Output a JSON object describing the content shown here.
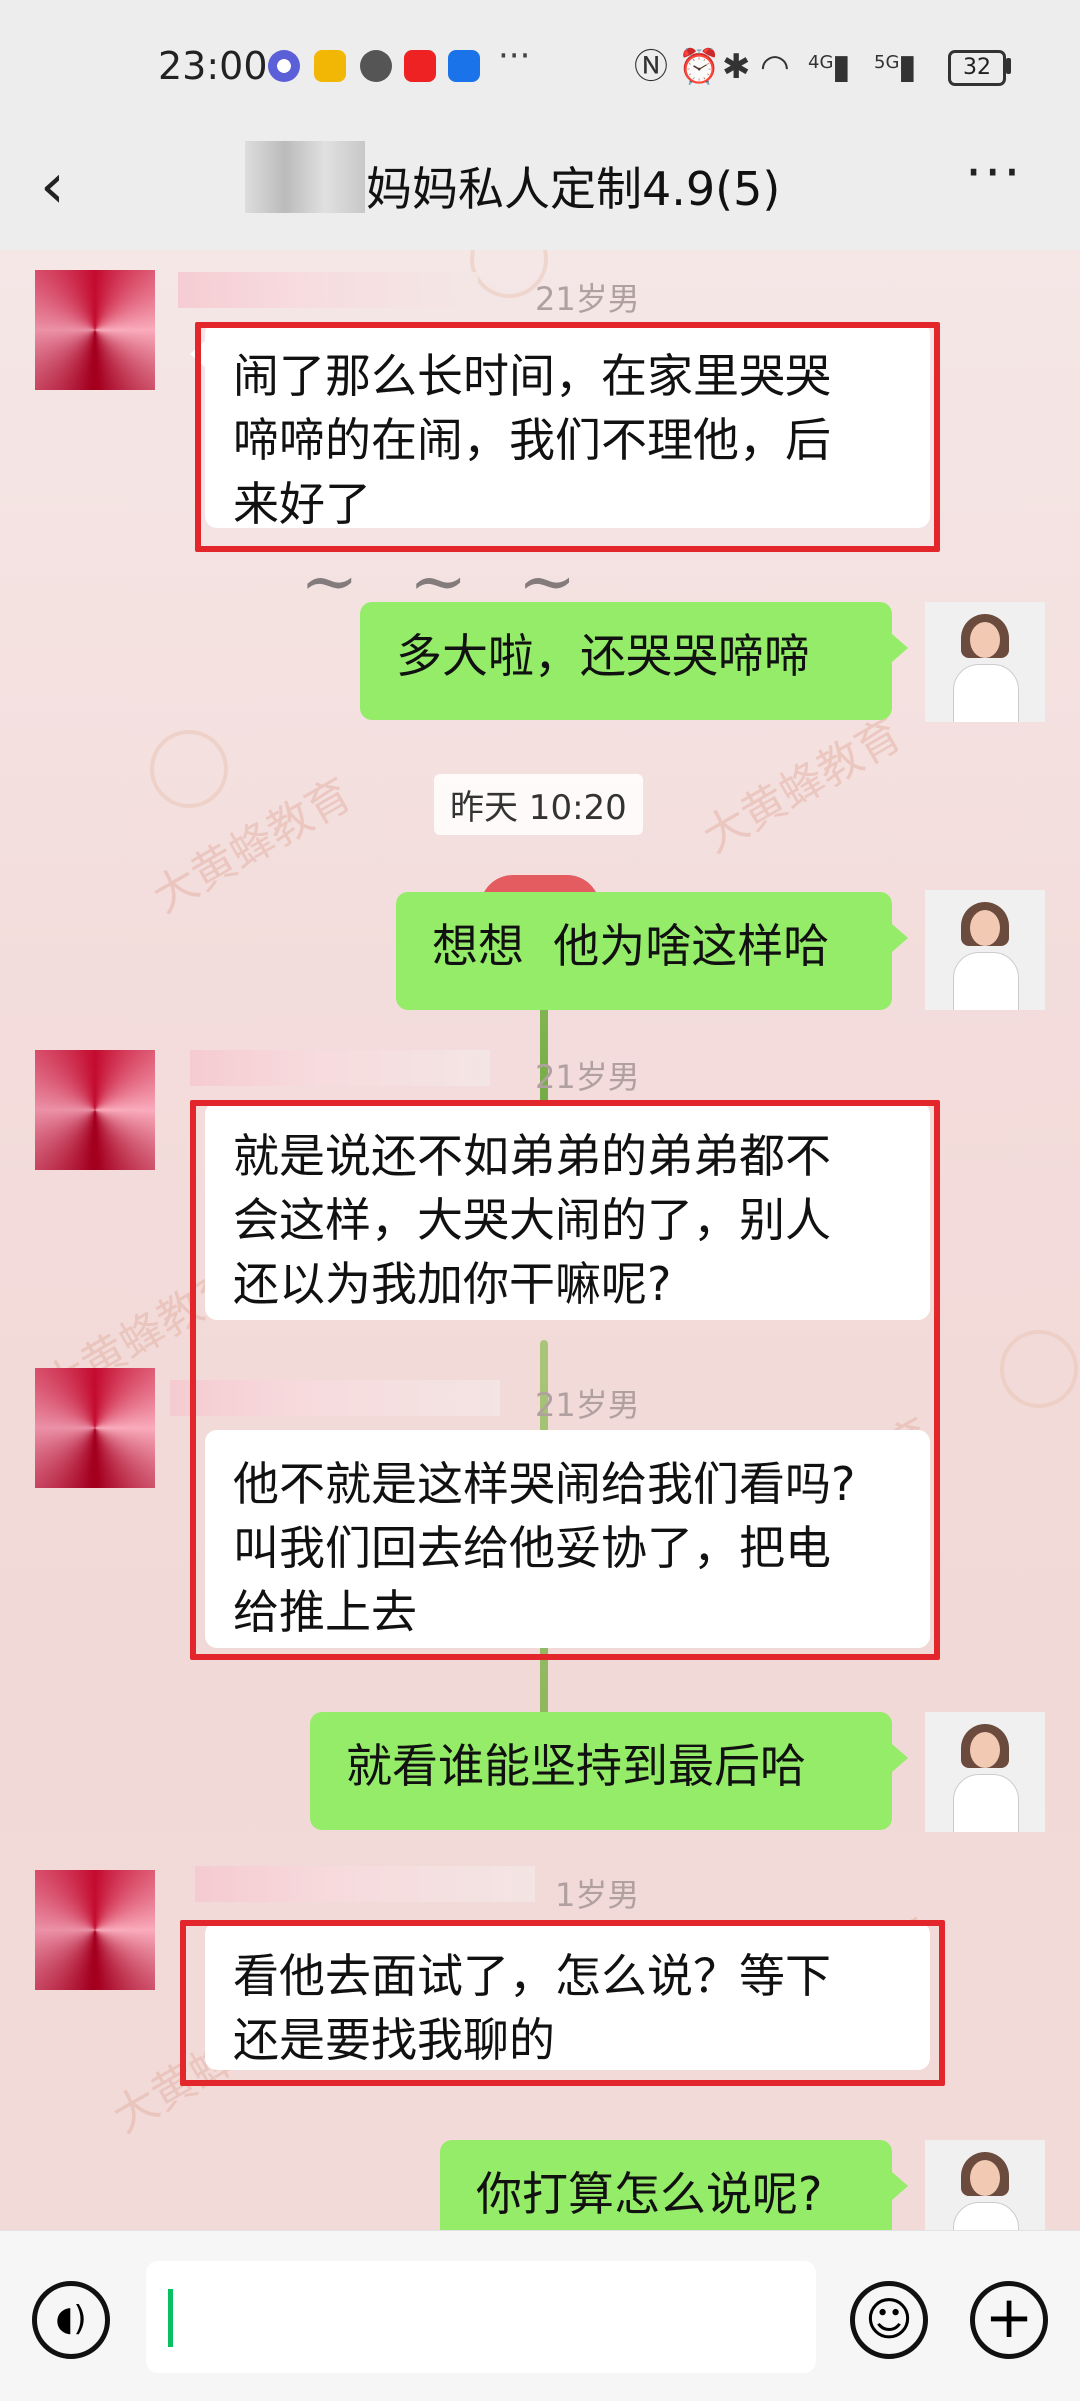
{
  "status_bar": {
    "time": "23:00",
    "more": "···",
    "battery": "32",
    "network_labels": [
      "4G",
      "5G"
    ]
  },
  "header": {
    "title": "妈妈私人定制4.9(5)",
    "back_icon": "chevron-left-icon",
    "more_icon": "more-dots-icon"
  },
  "background": {
    "watermark": "大黄蜂教育"
  },
  "messages": [
    {
      "side": "left",
      "age": "21岁男",
      "text": "闹了那么长时间，在家里哭哭\n啼啼的在闹，我们不理他，后\n来好了",
      "highlighted": true
    },
    {
      "side": "right",
      "text": "多大啦，还哭哭啼啼"
    },
    {
      "type": "time",
      "text": "昨天 10:20"
    },
    {
      "side": "right",
      "text": "想想  他为啥这样哈"
    },
    {
      "side": "left",
      "age": "21岁男",
      "text": "就是说还不如弟弟的弟弟都不\n会这样，大哭大闹的了，别人\n还以为我加你干嘛呢?",
      "highlighted": true
    },
    {
      "side": "left",
      "age": "21岁男",
      "text": "他不就是这样哭闹给我们看吗?\n叫我们回去给他妥协了，把电\n给推上去",
      "highlighted": true
    },
    {
      "side": "right",
      "text": "就看谁能坚持到最后哈"
    },
    {
      "side": "left",
      "age": "1岁男",
      "text": "看他去面试了，怎么说？等下\n还是要找我聊的",
      "highlighted": true
    },
    {
      "side": "right",
      "text": "你打算怎么说呢?"
    }
  ],
  "input_bar": {
    "voice_icon": "voice-icon",
    "emoji_icon": "emoji-icon",
    "plus_icon": "plus-icon",
    "value": ""
  },
  "colors": {
    "sent_bubble": "#95ec69",
    "received_bubble": "#ffffff",
    "highlight_border": "#e3262b",
    "caret": "#07c160"
  }
}
